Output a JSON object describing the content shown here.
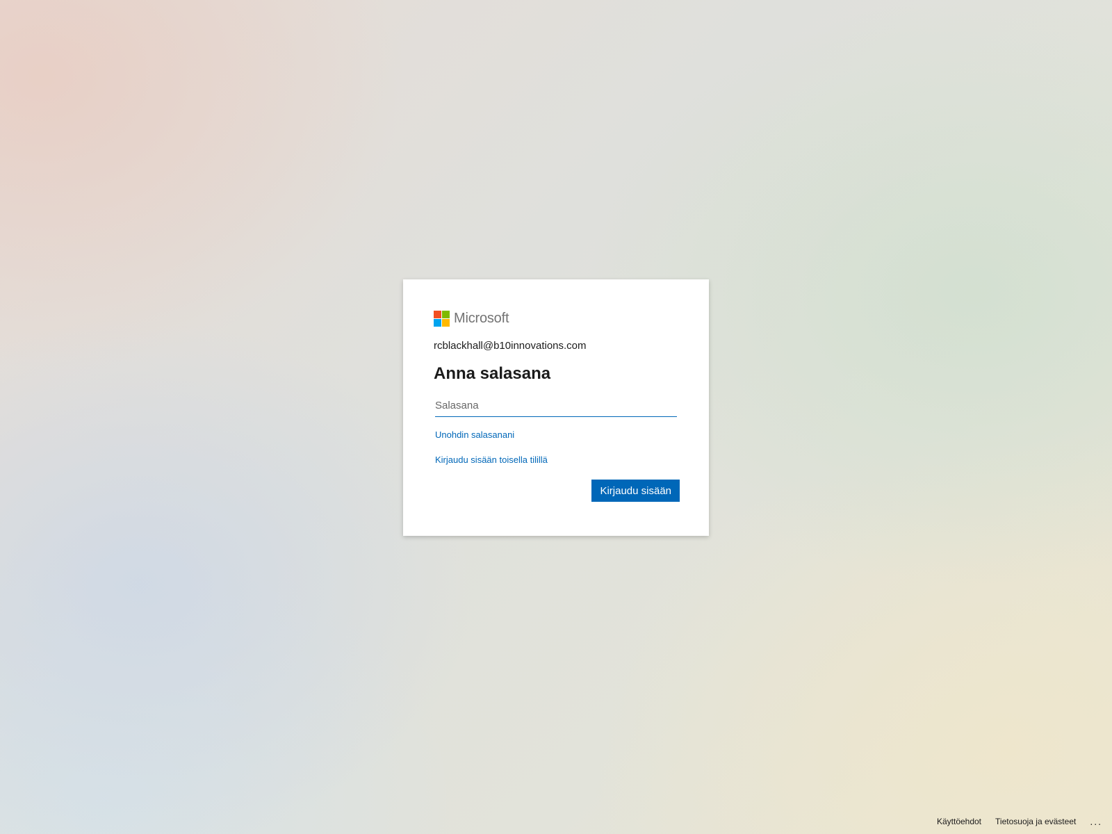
{
  "brand": {
    "name": "Microsoft",
    "logo_colors": {
      "red": "#f25022",
      "green": "#7fba00",
      "blue": "#00a4ef",
      "yellow": "#ffb900"
    }
  },
  "signin": {
    "identity": "rcblackhall@b10innovations.com",
    "title": "Anna salasana",
    "password_placeholder": "Salasana",
    "password_value": "",
    "forgot_password_link": "Unohdin salasanani",
    "other_account_link": "Kirjaudu sisään toisella tilillä",
    "submit_label": "Kirjaudu sisään"
  },
  "footer": {
    "terms_link": "Käyttöehdot",
    "privacy_link": "Tietosuoja ja evästeet",
    "more_label": "..."
  },
  "colors": {
    "accent": "#0067b8",
    "text": "#1b1b1b",
    "card_background": "#ffffff"
  }
}
